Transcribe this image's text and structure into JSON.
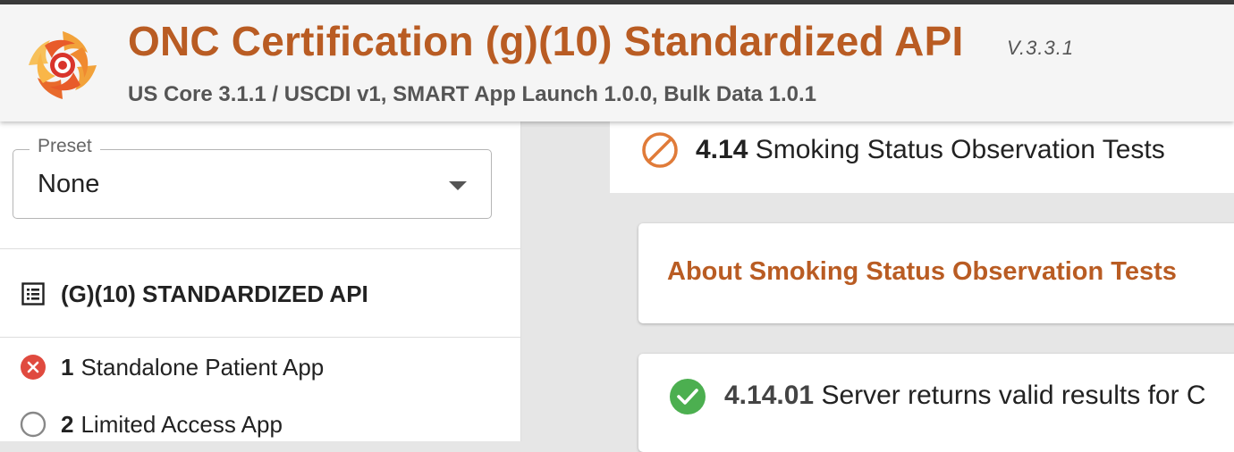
{
  "header": {
    "title": "ONC Certification (g)(10) Standardized API",
    "version": "V.3.3.1",
    "subtitle": "US Core 3.1.1 / USCDI v1, SMART App Launch 1.0.0, Bulk Data 1.0.1",
    "logo_icon": "inferno-logo-icon"
  },
  "sidebar": {
    "preset": {
      "label": "Preset",
      "value": "None"
    },
    "suite_title": "(G)(10) STANDARDIZED API",
    "items": [
      {
        "number": "1",
        "label": "Standalone Patient App",
        "status": "fail",
        "status_color": "#e04a3f"
      },
      {
        "number": "2",
        "label": "Limited Access App",
        "status": "not-run",
        "status_color": "#888888"
      }
    ]
  },
  "main": {
    "group": {
      "number": "4.14",
      "title": "Smoking Status Observation Tests",
      "status": "omitted",
      "status_color": "#e07b39"
    },
    "about_title": "About Smoking Status Observation Tests",
    "tests": [
      {
        "number": "4.14.01",
        "title": "Server returns valid results for C",
        "status": "pass",
        "status_color": "#4caf50"
      }
    ]
  },
  "colors": {
    "brand": "#b95c23",
    "text": "#222222"
  }
}
